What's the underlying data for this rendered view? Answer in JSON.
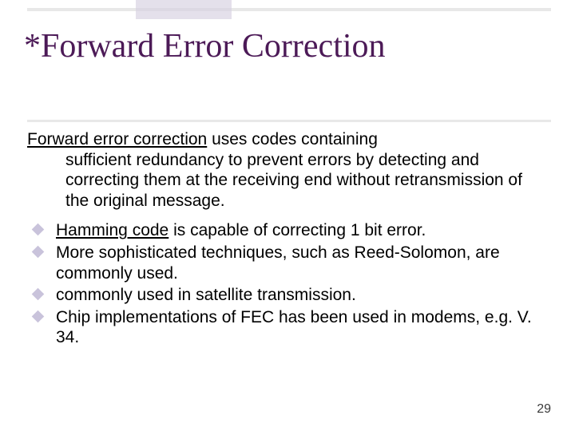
{
  "title": "*Forward Error Correction",
  "intro_lead": "Forward error correction",
  "intro_rest_first_line": " uses codes containing",
  "intro_rest_wrapped": "sufficient redundancy to prevent errors by detecting and correcting them at the receiving end without retransmission of the original message.",
  "bullets": [
    {
      "link": "Hamming code",
      "rest": " is capable of correcting 1 bit error."
    },
    {
      "text": "More sophisticated techniques, such as Reed-Solomon, are commonly used."
    },
    {
      "text": "commonly used in satellite transmission."
    },
    {
      "text": "Chip implementations of FEC has been used in modems, e.g. V. 34."
    }
  ],
  "page_number": "29"
}
